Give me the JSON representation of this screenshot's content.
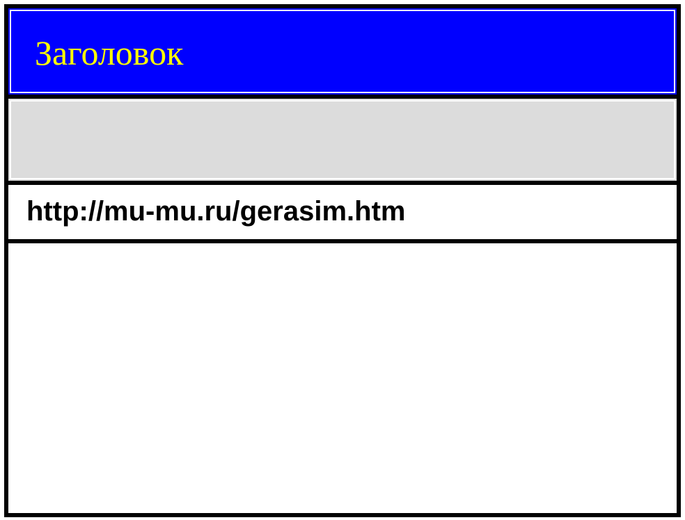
{
  "window": {
    "title": "Заголовок",
    "title_color": "#ffff00",
    "title_bar_color": "#0000ff"
  },
  "toolbar": {
    "background_color": "#dcdcdc"
  },
  "address_bar": {
    "url": "http://mu-mu.ru/gerasim.htm"
  },
  "content": {
    "text": ""
  }
}
